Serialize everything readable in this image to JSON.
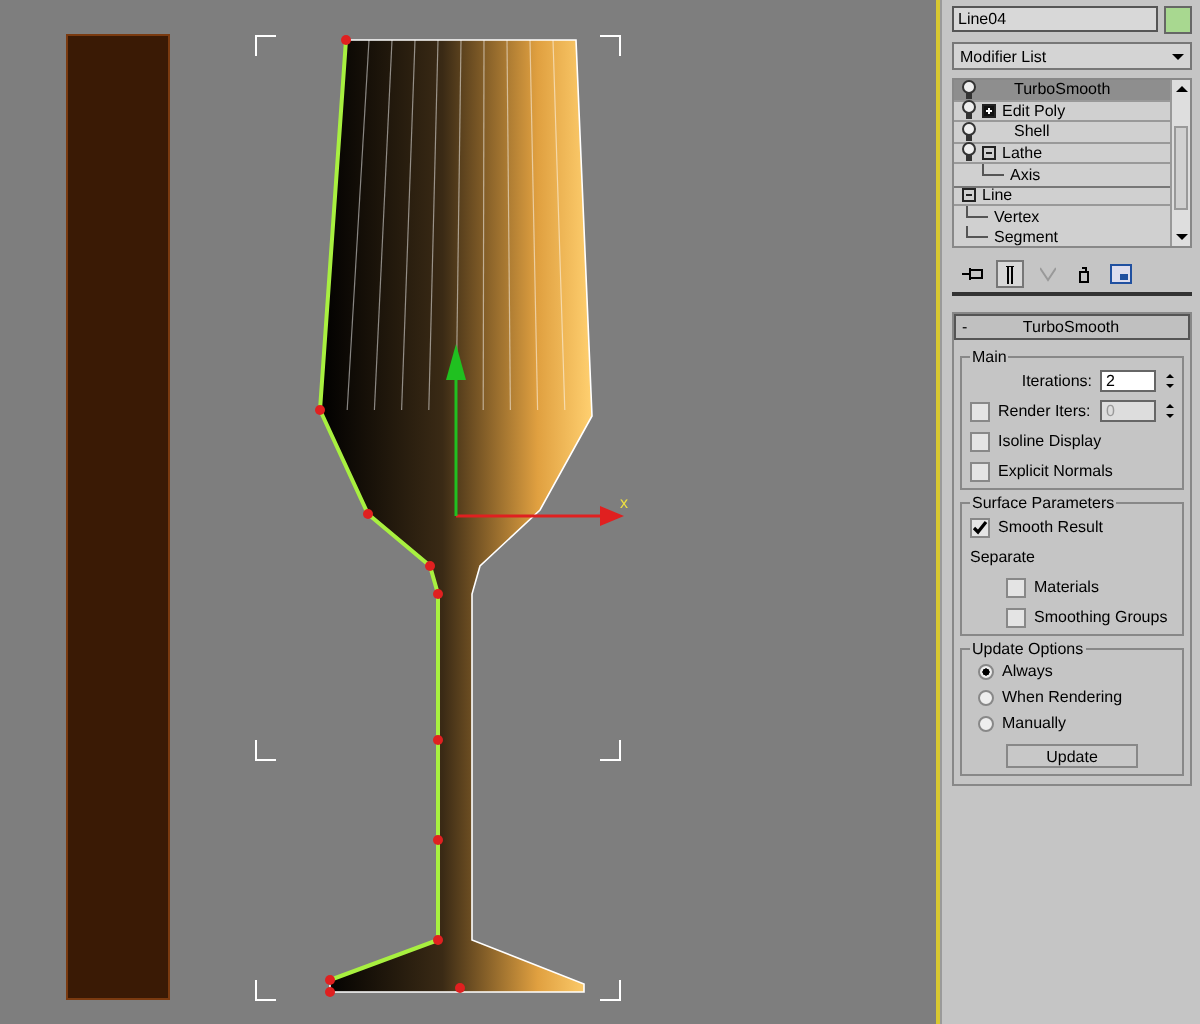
{
  "viewport": {
    "gizmo_label": "x"
  },
  "object": {
    "name": "Line04",
    "color": "#a8d890"
  },
  "modifier_list": {
    "label": "Modifier List"
  },
  "stack": [
    {
      "label": "TurboSmooth",
      "kind": "modifier",
      "selected": true
    },
    {
      "label": "Edit Poly",
      "kind": "modifier_expandable",
      "expanded": false,
      "selected": false
    },
    {
      "label": "Shell",
      "kind": "modifier",
      "selected": false
    },
    {
      "label": "Lathe",
      "kind": "modifier_expandable",
      "expanded": true,
      "selected": false,
      "children": [
        {
          "label": "Axis",
          "selected": false
        }
      ]
    },
    {
      "label": "Line",
      "kind": "base",
      "expanded": true,
      "selected": false,
      "children": [
        {
          "label": "Vertex",
          "selected": false
        },
        {
          "label": "Segment",
          "selected": false
        }
      ]
    }
  ],
  "rollout": {
    "title": "TurboSmooth",
    "collapse": "-",
    "groups": [
      {
        "title": "Main",
        "items": [
          {
            "kind": "spinner",
            "label": "Iterations:",
            "value": "2",
            "disabled": false
          },
          {
            "kind": "check_spinner",
            "label": "Render Iters:",
            "checked": false,
            "value": "0",
            "disabled": true
          },
          {
            "kind": "checkbox",
            "label": "Isoline Display",
            "checked": false
          },
          {
            "kind": "checkbox",
            "label": "Explicit Normals",
            "checked": false
          }
        ]
      },
      {
        "title": "Surface Parameters",
        "items": [
          {
            "kind": "checkbox",
            "label": "Smooth Result",
            "checked": true
          },
          {
            "kind": "label",
            "label": "Separate",
            "children": [
              {
                "kind": "checkbox",
                "label": "Materials",
                "checked": false
              },
              {
                "kind": "checkbox",
                "label": "Smoothing Groups",
                "checked": false
              }
            ]
          }
        ]
      },
      {
        "title": "Update Options",
        "items": [
          {
            "kind": "radio",
            "label": "Always",
            "selected": true
          },
          {
            "kind": "radio",
            "label": "When Rendering",
            "selected": false
          },
          {
            "kind": "radio",
            "label": "Manually",
            "selected": false
          },
          {
            "kind": "button",
            "label": "Update"
          }
        ]
      }
    ]
  }
}
